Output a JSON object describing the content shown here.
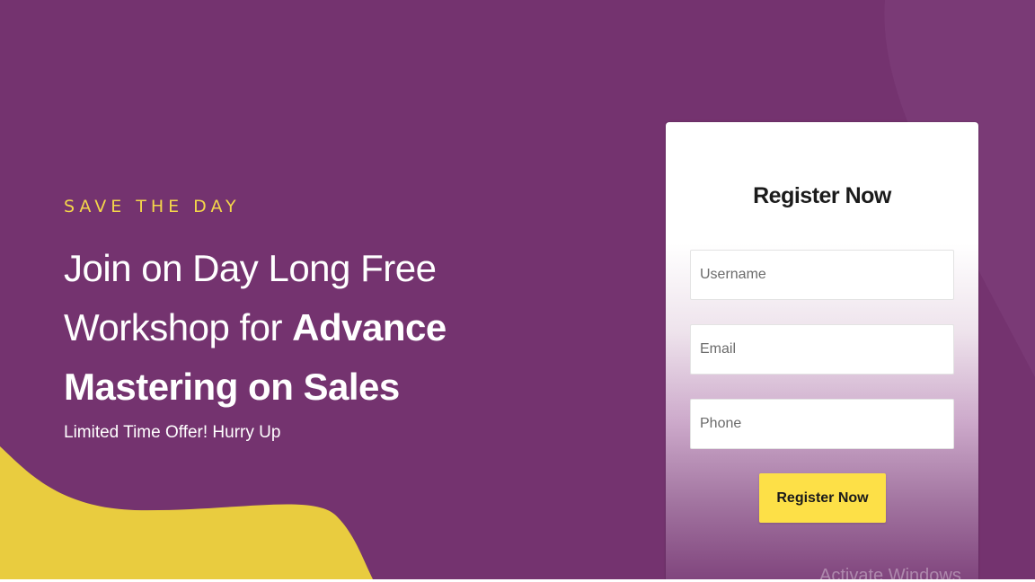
{
  "hero": {
    "eyebrow": "SAVE THE DAY",
    "headline_line1": "Join on Day Long Free",
    "headline_line2_regular": "Workshop for ",
    "headline_line2_bold": "Advance",
    "headline_line3_bold": "Mastering on Sales",
    "subtext": "Limited Time Offer! Hurry Up"
  },
  "form": {
    "title": "Register Now",
    "username_placeholder": "Username",
    "username_value": "",
    "email_placeholder": "Email",
    "email_value": "",
    "phone_placeholder": "Phone",
    "phone_value": "",
    "submit_label": "Register Now"
  },
  "watermark": "Activate Windows",
  "colors": {
    "background": "#74336f",
    "accent_yellow": "#f4d64a",
    "button_yellow": "#fde047",
    "text_white": "#ffffff"
  }
}
